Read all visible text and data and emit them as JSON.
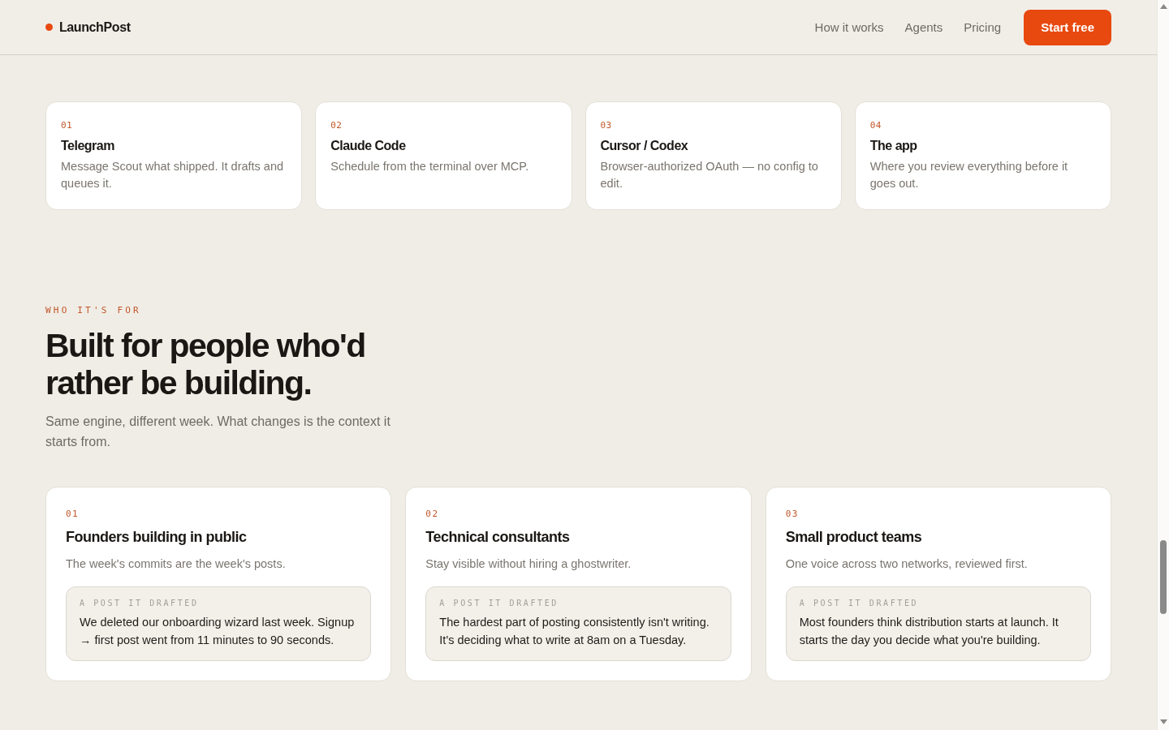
{
  "header": {
    "brand": "LaunchPost",
    "nav": [
      "How it works",
      "Agents",
      "Pricing"
    ],
    "cta": "Start free"
  },
  "integrations": [
    {
      "number": "01",
      "title": "Telegram",
      "text": "Message Scout what shipped. It drafts and queues it."
    },
    {
      "number": "02",
      "title": "Claude Code",
      "text": "Schedule from the terminal over MCP."
    },
    {
      "number": "03",
      "title": "Cursor / Codex",
      "text": "Browser-authorized OAuth — no config to edit."
    },
    {
      "number": "04",
      "title": "The app",
      "text": "Where you review everything before it goes out."
    }
  ],
  "audience": {
    "eyebrow": "WHO IT'S FOR",
    "heading": "Built for people who'd rather be building.",
    "subtitle": "Same engine, different week. What changes is the context it starts from.",
    "cards": [
      {
        "number": "01",
        "title": "Founders building in public",
        "text": "The week's commits are the week's posts.",
        "sample_label": "A POST IT DRAFTED",
        "sample": "We deleted our onboarding wizard last week. Signup → first post went from 11 minutes to 90 seconds."
      },
      {
        "number": "02",
        "title": "Technical consultants",
        "text": "Stay visible without hiring a ghostwriter.",
        "sample_label": "A POST IT DRAFTED",
        "sample": "The hardest part of posting consistently isn't writing. It's deciding what to write at 8am on a Tuesday."
      },
      {
        "number": "03",
        "title": "Small product teams",
        "text": "One voice across two networks, reviewed first.",
        "sample_label": "A POST IT DRAFTED",
        "sample": "Most founders think distribution starts at launch. It starts the day you decide what you're building."
      }
    ]
  }
}
